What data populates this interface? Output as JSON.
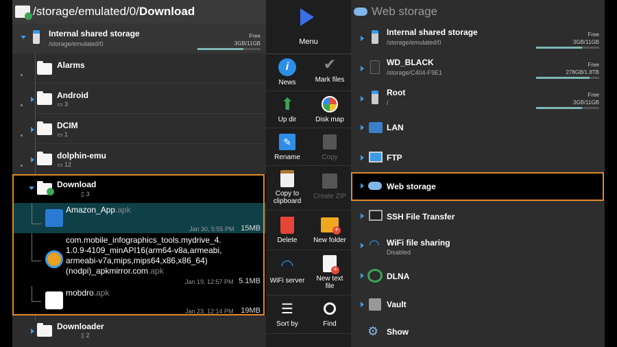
{
  "left": {
    "path_prefix": "/storage/emulated/0/",
    "path_current": "Download",
    "storage": {
      "name": "Internal shared storage",
      "path": "/storage/emulated/0",
      "free_label": "Free",
      "free_value": "3GB/11GB",
      "used_fraction": 0.73
    },
    "folders": [
      {
        "name": "Alarms",
        "count": ""
      },
      {
        "name": "Android",
        "count": "3"
      },
      {
        "name": "DCIM",
        "count": "1"
      },
      {
        "name": "dolphin-emu",
        "count": "12"
      }
    ],
    "download": {
      "name": "Download",
      "count": "3"
    },
    "files": [
      {
        "name": "Amazon_App",
        "ext": ".apk",
        "date": "Jan 30, 5:55 PM",
        "size": "15MB"
      },
      {
        "name_l1": "com.mobile_infographics_tools.mydrive_4.",
        "name_l2": "1.0.9-4109_minAPI16(arm64-v8a,armeabi,",
        "name_l3": "armeabi-v7a,mips,mips64,x86,x86_64)",
        "name_l4": "(nodpi)_apkmirror.com",
        "ext": ".apk",
        "date": "Jan 19, 12:57 PM",
        "size": "5.1MB"
      },
      {
        "name": "mobdro",
        "ext": ".apk",
        "date": "Jan 23, 12:14 PM",
        "size": "19MB"
      }
    ],
    "downloader": {
      "name": "Downloader",
      "count": "2"
    }
  },
  "menu": {
    "title": "Menu",
    "items": [
      {
        "label": "News",
        "icon": "info-icon"
      },
      {
        "label": "Mark files",
        "icon": "checkmark-icon"
      },
      {
        "label": "Up dir",
        "icon": "up-arrow-icon"
      },
      {
        "label": "Disk map",
        "icon": "pie-chart-icon"
      },
      {
        "label": "Rename",
        "icon": "pencil-icon"
      },
      {
        "label": "Copy",
        "icon": "copy-icon"
      },
      {
        "label": "Copy to",
        "label2": "clipboard",
        "icon": "clipboard-icon"
      },
      {
        "label": "Create ZIP",
        "icon": "zip-icon"
      },
      {
        "label": "Delete",
        "icon": "trash-icon"
      },
      {
        "label": "New folder",
        "icon": "new-folder-icon"
      },
      {
        "label": "WiFi server",
        "icon": "wifi-icon"
      },
      {
        "label": "New text",
        "label2": "file",
        "icon": "new-file-icon"
      },
      {
        "label": "Sort by",
        "icon": "sort-icon"
      },
      {
        "label": "Find",
        "icon": "search-icon"
      }
    ]
  },
  "right": {
    "title": "Web storage",
    "items": [
      {
        "name": "Internal shared storage",
        "path": "/storage/emulated/0",
        "free_label": "Free",
        "free_value": "3GB/11GB",
        "used_fraction": 0.73
      },
      {
        "name": "WD_BLACK",
        "path": "/storage/C404-F9E1",
        "free_label": "Free",
        "free_value": "278GB/1.8TB",
        "used_fraction": 0.85
      },
      {
        "name": "Root",
        "path": "/",
        "free_label": "Free",
        "free_value": "3GB/11GB",
        "used_fraction": 0.73
      },
      {
        "name": "LAN"
      },
      {
        "name": "FTP"
      },
      {
        "name": "Web storage"
      },
      {
        "name": "SSH File Transfer"
      },
      {
        "name": "WiFi file sharing",
        "sub": "Disabled"
      },
      {
        "name": "DLNA"
      },
      {
        "name": "Vault"
      },
      {
        "name": "Show"
      }
    ]
  },
  "colors": {
    "accent": "#3a9be8",
    "selection": "#e08a2a",
    "selected_row": "#0f4048"
  }
}
